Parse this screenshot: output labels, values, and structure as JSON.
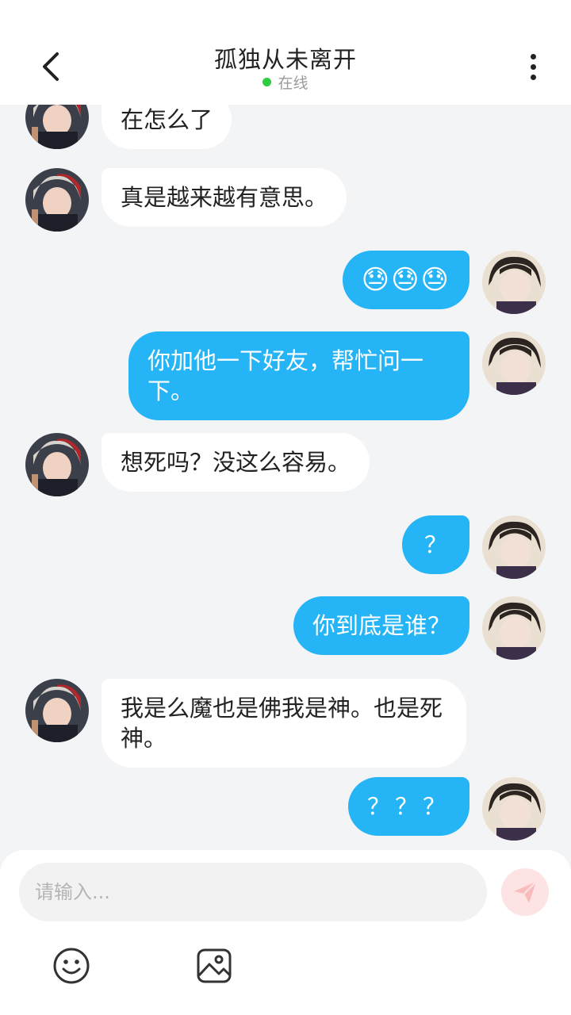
{
  "header": {
    "title": "孤独从未离开",
    "status": "在线",
    "status_color": "#2ecc40",
    "back_icon": "chevron-left-icon",
    "more_icon": "more-vertical-icon"
  },
  "messages": [
    {
      "side": "in",
      "text": "在怎么了"
    },
    {
      "side": "in",
      "text": "真是越来越有意思。"
    },
    {
      "side": "out",
      "text": "😓😓😓"
    },
    {
      "side": "out",
      "text": "你加他一下好友，帮忙问一下。"
    },
    {
      "side": "in",
      "text": "想死吗？没这么容易。"
    },
    {
      "side": "out",
      "text": "？"
    },
    {
      "side": "out",
      "text": "你到底是谁？"
    },
    {
      "side": "in",
      "text": "我是么魔也是佛我是神。也是死神。"
    },
    {
      "side": "out",
      "text": "？？？"
    }
  ],
  "composer": {
    "placeholder": "请输入...",
    "send_icon": "send-icon",
    "emoji_icon": "smiley-icon",
    "image_icon": "image-icon"
  },
  "colors": {
    "outgoing_bubble": "#25b4f5",
    "incoming_bubble": "#ffffff",
    "background": "#f3f4f6"
  }
}
